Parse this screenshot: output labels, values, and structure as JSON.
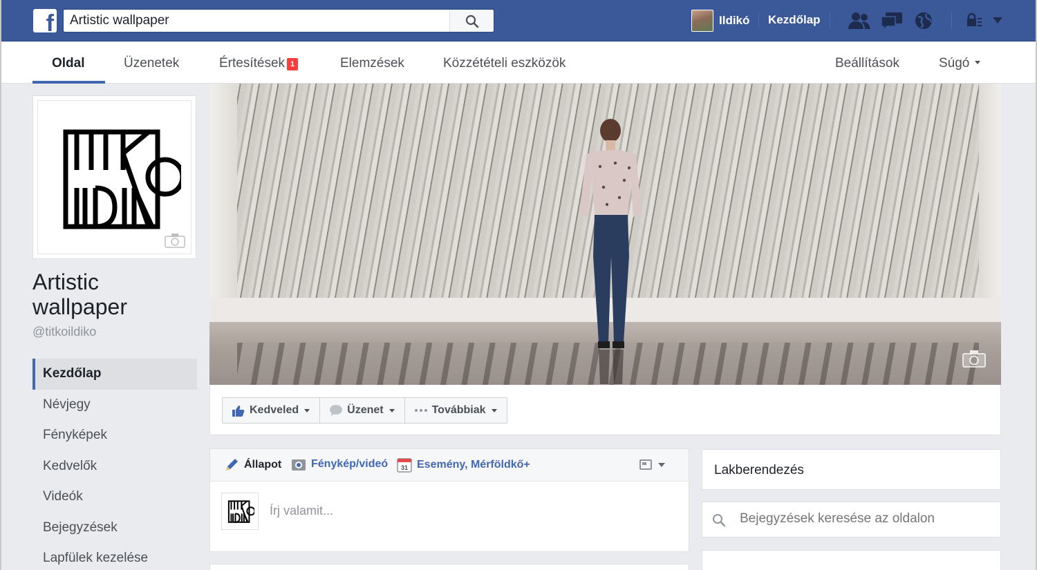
{
  "topbar": {
    "search_value": "Artistic wallpaper",
    "user_name": "Ildikó",
    "home_label": "Kezdőlap",
    "brand_color": "#3b5998"
  },
  "pagenav": {
    "tabs": [
      {
        "label": "Oldal",
        "active": true
      },
      {
        "label": "Üzenetek"
      },
      {
        "label": "Értesítések",
        "badge": "1"
      },
      {
        "label": "Elemzések"
      },
      {
        "label": "Közzétételi eszközök"
      }
    ],
    "settings_label": "Beállítások",
    "help_label": "Súgó"
  },
  "page": {
    "title": "Artistic wallpaper",
    "handle": "@titkoildiko"
  },
  "leftnav": {
    "items": [
      {
        "label": "Kezdőlap",
        "active": true
      },
      {
        "label": "Névjegy"
      },
      {
        "label": "Fényképek"
      },
      {
        "label": "Kedvelők"
      },
      {
        "label": "Videók"
      },
      {
        "label": "Bejegyzések"
      },
      {
        "label": "Lapfülek kezelése"
      }
    ]
  },
  "actions": {
    "like_label": "Kedveled",
    "message_label": "Üzenet",
    "more_label": "Továbbiak"
  },
  "composer": {
    "status_label": "Állapot",
    "photo_label": "Fénykép/videó",
    "event_label": "Esemény, Mérföldkő+",
    "calendar_day": "31",
    "placeholder": "Írj valamit..."
  },
  "right": {
    "category": "Lakberendezés",
    "search_placeholder": "Bejegyzések keresése az oldalon"
  }
}
